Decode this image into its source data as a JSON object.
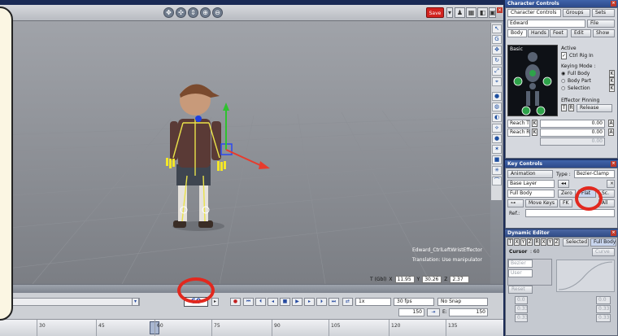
{
  "toolbar": {
    "save_label": "Save"
  },
  "viewport": {
    "hud_line1": "Edward_CtrlLeftWristEffector",
    "hud_line2": "Translation: Use manipulator",
    "coord_prefix": "T (Gbl)",
    "x_label": "X",
    "x_value": "11.95",
    "y_label": "Y",
    "y_value": "30.26",
    "z_label": "Z",
    "z_value": "2.37"
  },
  "timeline": {
    "current_frame": "60",
    "speed": "1x",
    "fps": "30 fps",
    "snap": "No Snap",
    "end_frame": "150",
    "end_label": "E:",
    "end_value": "150",
    "ticks": [
      "30",
      "45",
      "60",
      "75",
      "90",
      "105",
      "120",
      "135"
    ]
  },
  "character_controls": {
    "title": "Character Controls",
    "tabs": [
      "Character Controls",
      "Groups",
      "Sets"
    ],
    "character": "Edward",
    "file_label": "File",
    "sub_tabs": [
      "Body",
      "Hands",
      "Feet"
    ],
    "edit_label": "Edit",
    "show_label": "Show",
    "basic_label": "Basic",
    "active_label": "Active",
    "ctrl_rig_label": "Ctrl Rig In",
    "keying_mode_label": "Keying Mode :",
    "full_body": "Full Body",
    "body_part": "Body Part",
    "selection": "Selection",
    "k": "K",
    "effector_pinning": "Effector Pinning",
    "t": "T",
    "r": "R",
    "release": "Release",
    "reach_t": "Reach T",
    "reach_r": "Reach R",
    "reach_t_value": "0.00",
    "reach_r_value": "0.00",
    "third_value": "0.00",
    "a": "A",
    "rig_labels": [
      "R",
      "TR",
      "TR"
    ]
  },
  "key_controls": {
    "title": "Key Controls",
    "animation_label": "Animation",
    "type_label": "Type :",
    "type_value": "Bezier-Clamp",
    "base_layer": "Base Layer",
    "full_body": "Full Body",
    "zero_label": "Zero",
    "flat_label": "Flat",
    "sc_label": "Sc.",
    "move_keys": "Move Keys",
    "fk": "FK",
    "all_label": "All",
    "ref_label": "Ref.:"
  },
  "dynamic_editor": {
    "title": "Dynamic Editor",
    "axes": [
      "T",
      "X",
      "Y",
      "Z",
      "R",
      "X",
      "Y",
      "Z"
    ],
    "selected": "Selected",
    "full_body": "Full Body",
    "cursor_label": "Cursor",
    "cursor_value": ": 60",
    "curve_label": "Curve",
    "bezier": "Bezier",
    "user": "User",
    "reset": "Reset",
    "values": [
      "0.0",
      "0.0",
      "0.33",
      "0.33",
      "0.33",
      "0.33"
    ]
  }
}
